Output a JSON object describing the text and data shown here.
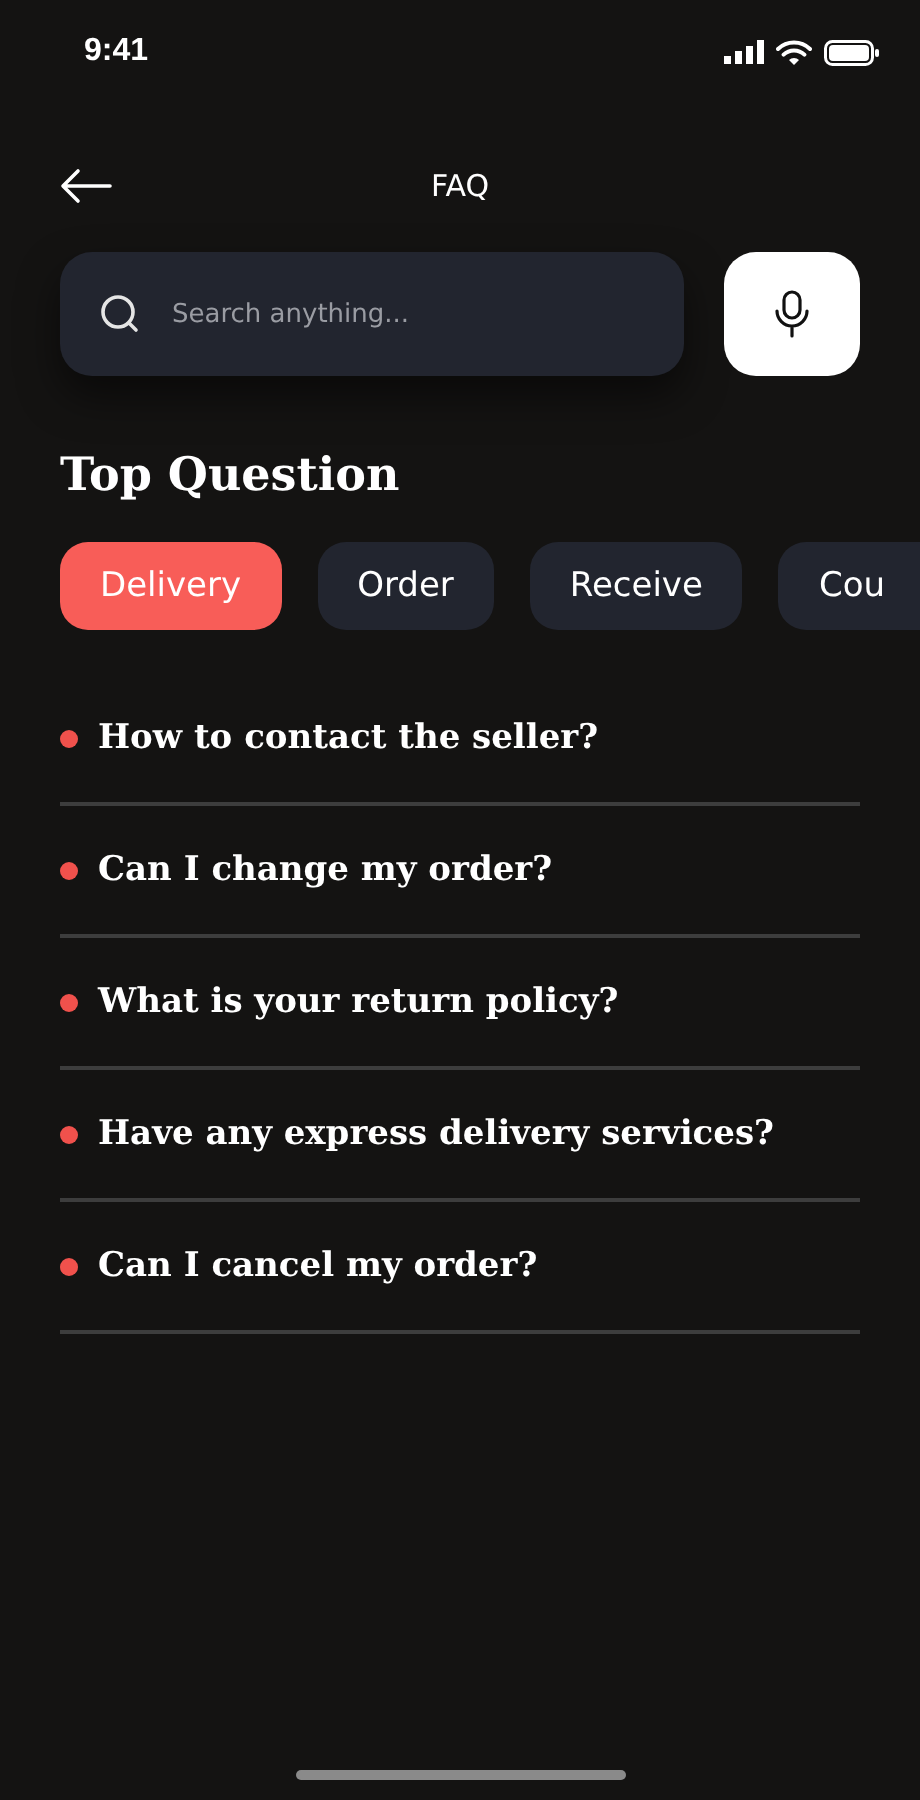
{
  "status_bar": {
    "time": "9:41"
  },
  "header": {
    "title": "FAQ"
  },
  "search": {
    "placeholder": "Search anything..."
  },
  "section_title": "Top Question",
  "tabs": [
    {
      "label": "Delivery",
      "selected": true
    },
    {
      "label": "Order",
      "selected": false
    },
    {
      "label": "Receive",
      "selected": false
    },
    {
      "label": "Cou",
      "selected": false
    }
  ],
  "questions": [
    "How to contact the seller?",
    "Can I change my order?",
    "What is your return policy?",
    "Have any express delivery services?",
    "Can I cancel my order?"
  ]
}
